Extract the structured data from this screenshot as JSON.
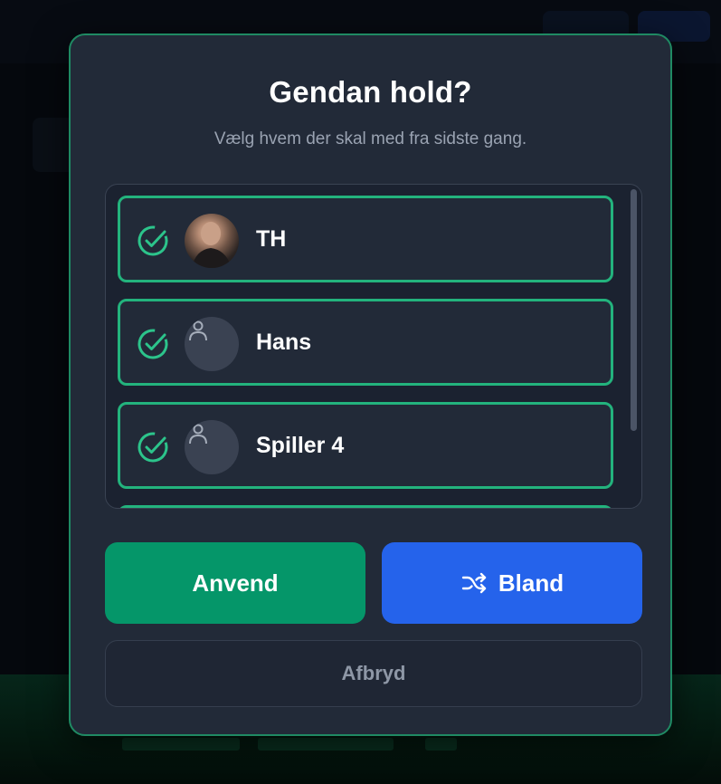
{
  "dialog": {
    "title": "Gendan hold?",
    "subtitle": "Vælg hvem der skal med fra sidste gang."
  },
  "players": [
    {
      "name": "TH",
      "selected": true,
      "avatar": "photo"
    },
    {
      "name": "Hans",
      "selected": true,
      "avatar": "person-icon"
    },
    {
      "name": "Spiller 4",
      "selected": true,
      "avatar": "person-icon"
    }
  ],
  "actions": {
    "apply_label": "Anvend",
    "shuffle_label": "Bland",
    "shuffle_icon": "shuffle-icon",
    "cancel_label": "Afbryd"
  },
  "colors": {
    "accent_green": "#059669",
    "accent_blue": "#2563eb",
    "border_green": "#23b37d",
    "modal_bg": "#222a38"
  }
}
